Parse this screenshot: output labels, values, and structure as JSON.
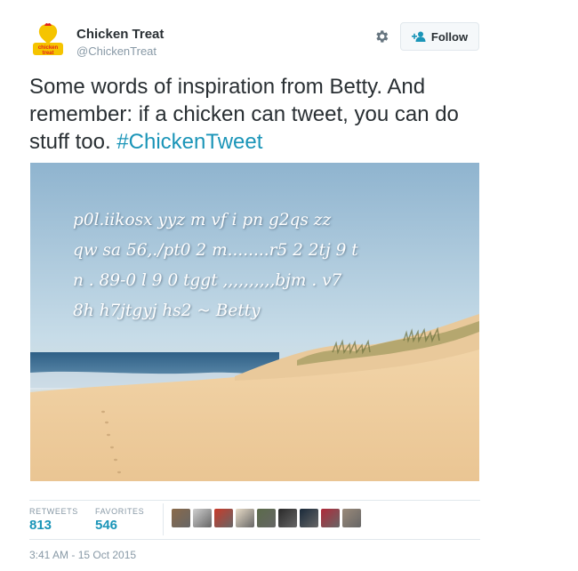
{
  "author": {
    "name": "Chicken Treat",
    "handle": "@ChickenTreat",
    "avatar_text": "chicken treat",
    "avatar_icon": "chicken-treat-logo-icon"
  },
  "actions": {
    "gear_icon": "gear-icon",
    "follow_label": "Follow",
    "follow_icon": "add-user-icon"
  },
  "tweet": {
    "text": "Some words of inspiration from Betty. And remember: if a chicken can tweet, you can do stuff too. ",
    "hashtag": "#ChickenTweet",
    "image_quote": "p0l.iikosx yyz m vf i pn g2qs zz\nqw sa 56,./pt0 2 m........r5 2 2tj 9 t\nn . 89-0 l 9 0 tggt ,,,,,,,,,,bjm . v7\n8h h7jtgyj hs2  ~ Betty"
  },
  "stats": {
    "retweets_label": "RETWEETS",
    "retweets_value": "813",
    "favorites_label": "FAVORITES",
    "favorites_value": "546"
  },
  "favoriters": [
    {
      "name": "user-avatar-1",
      "color": "#8a6a4a"
    },
    {
      "name": "user-avatar-2",
      "color": "#cfcfcf"
    },
    {
      "name": "user-avatar-3",
      "color": "#c93a2a"
    },
    {
      "name": "user-avatar-4",
      "color": "#e8dcc8"
    },
    {
      "name": "user-avatar-5",
      "color": "#5b6b4a"
    },
    {
      "name": "user-avatar-6",
      "color": "#2a2a2a"
    },
    {
      "name": "user-avatar-7",
      "color": "#1a2a3a"
    },
    {
      "name": "user-avatar-8",
      "color": "#b02a3a"
    },
    {
      "name": "user-avatar-9",
      "color": "#9a8a7a"
    }
  ],
  "timestamp": "3:41 AM - 15 Oct 2015",
  "colors": {
    "accent": "#1b95b8",
    "muted": "#8899a6",
    "avatar_yellow": "#f5c400",
    "avatar_red": "#e2231a"
  }
}
